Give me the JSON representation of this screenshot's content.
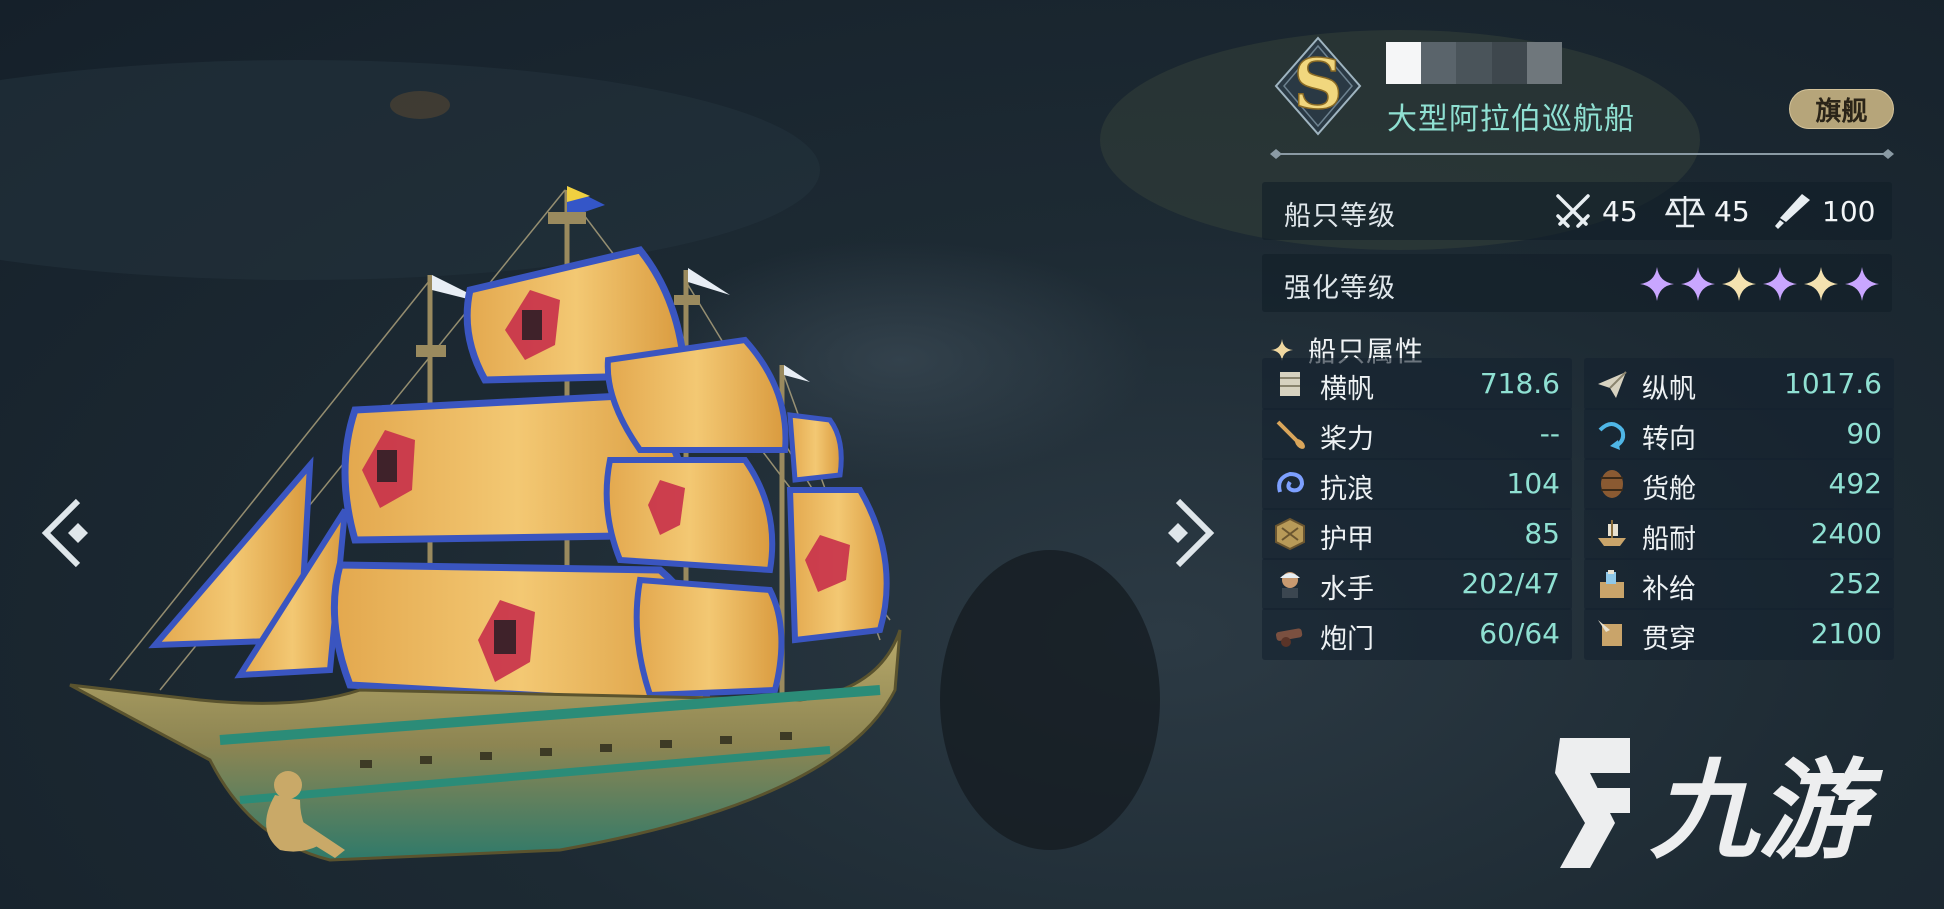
{
  "ship": {
    "rank": "S",
    "class_name": "大型阿拉伯巡航船",
    "flagship_label": "旗舰"
  },
  "level": {
    "label": "船只等级",
    "stats": [
      {
        "icon": "crossed-swords-icon",
        "value": "45"
      },
      {
        "icon": "balance-scale-icon",
        "value": "45"
      },
      {
        "icon": "telescope-icon",
        "value": "100"
      }
    ]
  },
  "enhance": {
    "label": "强化等级",
    "stars": [
      {
        "color": "#c9a6ff"
      },
      {
        "color": "#c9a6ff"
      },
      {
        "color": "#f4e2b0"
      },
      {
        "color": "#c9a6ff"
      },
      {
        "color": "#f4e2b0"
      },
      {
        "color": "#c9a6ff"
      }
    ]
  },
  "attributes": {
    "title": "船只属性",
    "items": [
      {
        "label": "横帆",
        "value": "718.6",
        "icon": "square-sail-icon"
      },
      {
        "label": "纵帆",
        "value": "1017.6",
        "icon": "paper-plane-sail-icon"
      },
      {
        "label": "桨力",
        "value": "--",
        "icon": "oar-icon"
      },
      {
        "label": "转向",
        "value": "90",
        "icon": "turn-arrow-icon"
      },
      {
        "label": "抗浪",
        "value": "104",
        "icon": "wave-icon"
      },
      {
        "label": "货舱",
        "value": "492",
        "icon": "barrel-icon"
      },
      {
        "label": "护甲",
        "value": "85",
        "icon": "armor-plate-icon"
      },
      {
        "label": "船耐",
        "value": "2400",
        "icon": "ship-hull-icon"
      },
      {
        "label": "水手",
        "value": "202/47",
        "icon": "sailor-icon"
      },
      {
        "label": "补给",
        "value": "252",
        "icon": "supply-crate-icon"
      },
      {
        "label": "炮门",
        "value": "60/64",
        "icon": "cannon-icon"
      },
      {
        "label": "贯穿",
        "value": "2100",
        "icon": "piercing-icon"
      }
    ]
  },
  "watermark": {
    "text": "九游",
    "icon": "jiuyou-logo-icon"
  },
  "colors": {
    "accent_teal": "#8fe0d2",
    "flagship_gold": "#b6a57a",
    "star_purple": "#c9a6ff",
    "star_gold": "#f4e2b0"
  }
}
